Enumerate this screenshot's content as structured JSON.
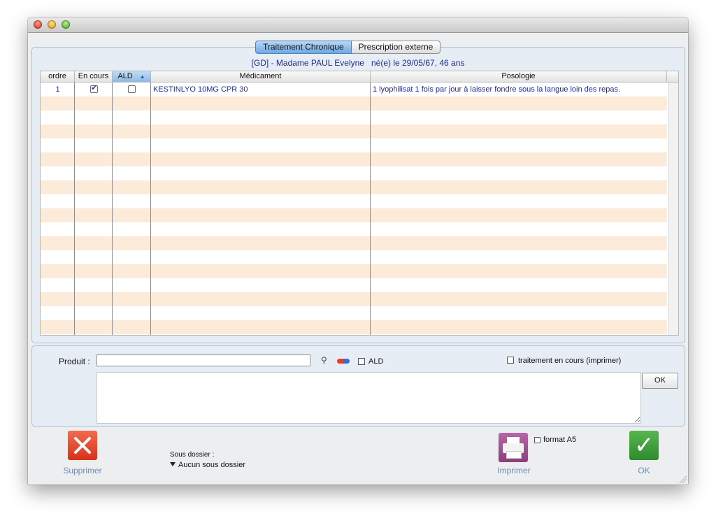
{
  "tabs": [
    {
      "label": "Traitement Chronique",
      "selected": true
    },
    {
      "label": "Prescription externe",
      "selected": false
    }
  ],
  "patient": {
    "name": "[GD] - Madame PAUL Evelyne",
    "birth": "né(e) le 29/05/67, 46 ans"
  },
  "table": {
    "columns": [
      "ordre",
      "En cours",
      "ALD",
      "Médicament",
      "Posologie"
    ],
    "rows": [
      {
        "ordre": "1",
        "en_cours": true,
        "ald": false,
        "medicament": "KESTINLYO 10MG CPR 30",
        "posologie": "1 lyophilisat 1 fois par jour à laisser fondre sous la langue loin des repas."
      }
    ]
  },
  "form": {
    "produit_label": "Produit :",
    "produit_value": "",
    "ald_label": "ALD",
    "traitement_label": "traitement en cours (imprimer)",
    "ok_label": "OK"
  },
  "footer": {
    "supprimer_label": "Supprimer",
    "sous_dossier_label": "Sous dossier :",
    "sous_dossier_value": "Aucun sous dossier",
    "format_label": "format A5",
    "imprimer_label": "Imprimer",
    "ok_label": "OK"
  },
  "icons": [
    "search-icon",
    "pill-icon",
    "delete-icon",
    "printer-icon",
    "checkmark-icon"
  ],
  "colors": {
    "row_alt": "#fdebd9",
    "text_blue": "#1e2a9a",
    "accent": "#6ea8e3"
  }
}
